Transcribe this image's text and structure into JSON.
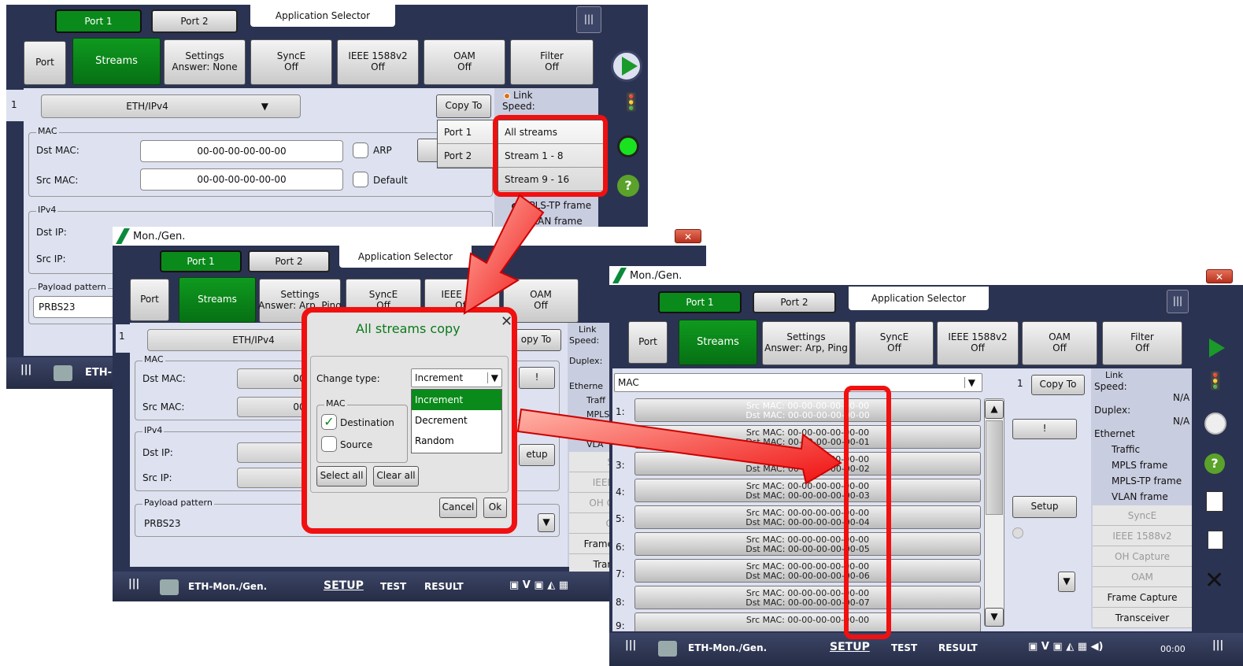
{
  "win1": {
    "port_tabs": [
      "Port 1",
      "Port 2"
    ],
    "app_selector": "Application Selector",
    "tabs": [
      {
        "l1": "Port",
        "l2": ""
      },
      {
        "l1": "Streams",
        "l2": ""
      },
      {
        "l1": "Settings",
        "l2": "Answer: None"
      },
      {
        "l1": "SyncE",
        "l2": "Off"
      },
      {
        "l1": "IEEE 1588v2",
        "l2": "Off"
      },
      {
        "l1": "OAM",
        "l2": "Off"
      },
      {
        "l1": "Filter",
        "l2": "Off"
      }
    ],
    "stream_num": "1",
    "frame_type": "ETH/IPv4",
    "copy_to": "Copy To",
    "copy_menu": [
      "Port 1",
      "Port 2"
    ],
    "copy_submenu": [
      "All streams",
      "Stream 1 - 8",
      "Stream 9 - 16"
    ],
    "link_label": "Link",
    "speed_label": "Speed:",
    "mac_group": "MAC",
    "dst_mac_label": "Dst MAC:",
    "dst_mac": "00-00-00-00-00-00",
    "arp_label": "ARP",
    "src_mac_label": "Src MAC:",
    "src_mac": "00-00-00-00-00-00",
    "default_label": "Default",
    "ipv4_group": "IPv4",
    "dst_ip_label": "Dst IP:",
    "src_ip_label": "Src IP:",
    "payload_group": "Payload pattern",
    "payload": "PRBS23",
    "mpls_tp": "MPLS-TP frame",
    "vlan": "VLAN frame",
    "taskbar_app": "ETH-"
  },
  "win2": {
    "title": "Mon./Gen.",
    "port_tabs": [
      "Port 1",
      "Port 2"
    ],
    "app_selector": "Application Selector",
    "tabs": [
      {
        "l1": "Port",
        "l2": ""
      },
      {
        "l1": "Streams",
        "l2": ""
      },
      {
        "l1": "Settings",
        "l2": "Answer: Arp, Ping"
      },
      {
        "l1": "SyncE",
        "l2": "Off"
      },
      {
        "l1": "IEEE 158",
        "l2": "Off"
      },
      {
        "l1": "OAM",
        "l2": "Off"
      }
    ],
    "stream_num": "1",
    "frame_type": "ETH/IPv4",
    "copy_to": "opy To",
    "link_label": "Link",
    "speed_label": "Speed:",
    "duplex_label": "Duplex:",
    "ethernet_label": "Etherne",
    "traffic_label": "Traff",
    "mpls_label": "MPLS",
    "vlan_label": "VLA",
    "side_items": [
      "S",
      "IEEE",
      "OH C",
      "O",
      "Frame",
      "Tran"
    ],
    "mac_group": "MAC",
    "dst_mac_label": "Dst MAC:",
    "dst_mac": "00-",
    "src_mac_label": "Src MAC:",
    "src_mac": "00-",
    "ipv4_group": "IPv4",
    "dst_ip_label": "Dst IP:",
    "src_ip_label": "Src IP:",
    "payload_group": "Payload pattern",
    "payload": "PRBS23",
    "excl": "!",
    "setup": "etup",
    "taskbar_app": "ETH-Mon./Gen.",
    "nav": [
      "SETUP",
      "TEST",
      "RESULT"
    ]
  },
  "dialog": {
    "title": "All streams copy",
    "change_type_label": "Change type:",
    "change_type_value": "Increment",
    "options": [
      "Increment",
      "Decrement",
      "Random"
    ],
    "mac_group": "MAC",
    "destination": "Destination",
    "source": "Source",
    "select_all": "Select all",
    "clear_all": "Clear all",
    "cancel": "Cancel",
    "ok": "Ok"
  },
  "win3": {
    "title": "Mon./Gen.",
    "port_tabs": [
      "Port 1",
      "Port 2"
    ],
    "app_selector": "Application Selector",
    "tabs": [
      {
        "l1": "Port",
        "l2": ""
      },
      {
        "l1": "Streams",
        "l2": ""
      },
      {
        "l1": "Settings",
        "l2": "Answer: Arp, Ping"
      },
      {
        "l1": "SyncE",
        "l2": "Off"
      },
      {
        "l1": "IEEE 1588v2",
        "l2": "Off"
      },
      {
        "l1": "OAM",
        "l2": "Off"
      },
      {
        "l1": "Filter",
        "l2": "Off"
      }
    ],
    "mac_dropdown": "MAC",
    "stream_num": "1",
    "copy_to": "Copy To",
    "rows": [
      {
        "n": "1:",
        "src": "Src MAC: 00-00-00-00-00-00",
        "dst": "Dst MAC: 00-00-00-00-00-00"
      },
      {
        "n": "",
        "src": "Src MAC: 00-00-00-00-00-00",
        "dst": "Dst MAC: 00-00-00-00-00-01"
      },
      {
        "n": "3:",
        "src": "Src MAC: 00-00-00-00-00-00",
        "dst": "Dst MAC: 00-00-00-00-00-02"
      },
      {
        "n": "4:",
        "src": "Src MAC: 00-00-00-00-00-00",
        "dst": "Dst MAC: 00-00-00-00-00-03"
      },
      {
        "n": "5:",
        "src": "Src MAC: 00-00-00-00-00-00",
        "dst": "Dst MAC: 00-00-00-00-00-04"
      },
      {
        "n": "6:",
        "src": "Src MAC: 00-00-00-00-00-00",
        "dst": "Dst MAC: 00-00-00-00-00-05"
      },
      {
        "n": "7:",
        "src": "Src MAC: 00-00-00-00-00-00",
        "dst": "Dst MAC: 00-00-00-00-00-06"
      },
      {
        "n": "8:",
        "src": "Src MAC: 00-00-00-00-00-00",
        "dst": "Dst MAC: 00-00-00-00-00-07"
      },
      {
        "n": "9:",
        "src": "Src MAC: 00-00-00-00-00-00",
        "dst": ""
      }
    ],
    "excl": "!",
    "setup": "Setup",
    "link_label": "Link",
    "speed_label": "Speed:",
    "speed_value": "N/A",
    "duplex_label": "Duplex:",
    "duplex_value": "N/A",
    "ethernet_label": "Ethernet",
    "eth_items": [
      "Traffic",
      "MPLS frame",
      "MPLS-TP frame",
      "VLAN frame"
    ],
    "side_items": [
      "SyncE",
      "IEEE 1588v2",
      "OH Capture",
      "OAM",
      "Frame Capture",
      "Transceiver"
    ],
    "taskbar_app": "ETH-Mon./Gen.",
    "nav": [
      "SETUP",
      "TEST",
      "RESULT"
    ],
    "clock": "00:00"
  },
  "colors": {
    "accent_green": "#0a8a1a",
    "highlight_red": "#f01010",
    "window_bg": "#2b3352",
    "panel_bg": "#dde1f0"
  }
}
